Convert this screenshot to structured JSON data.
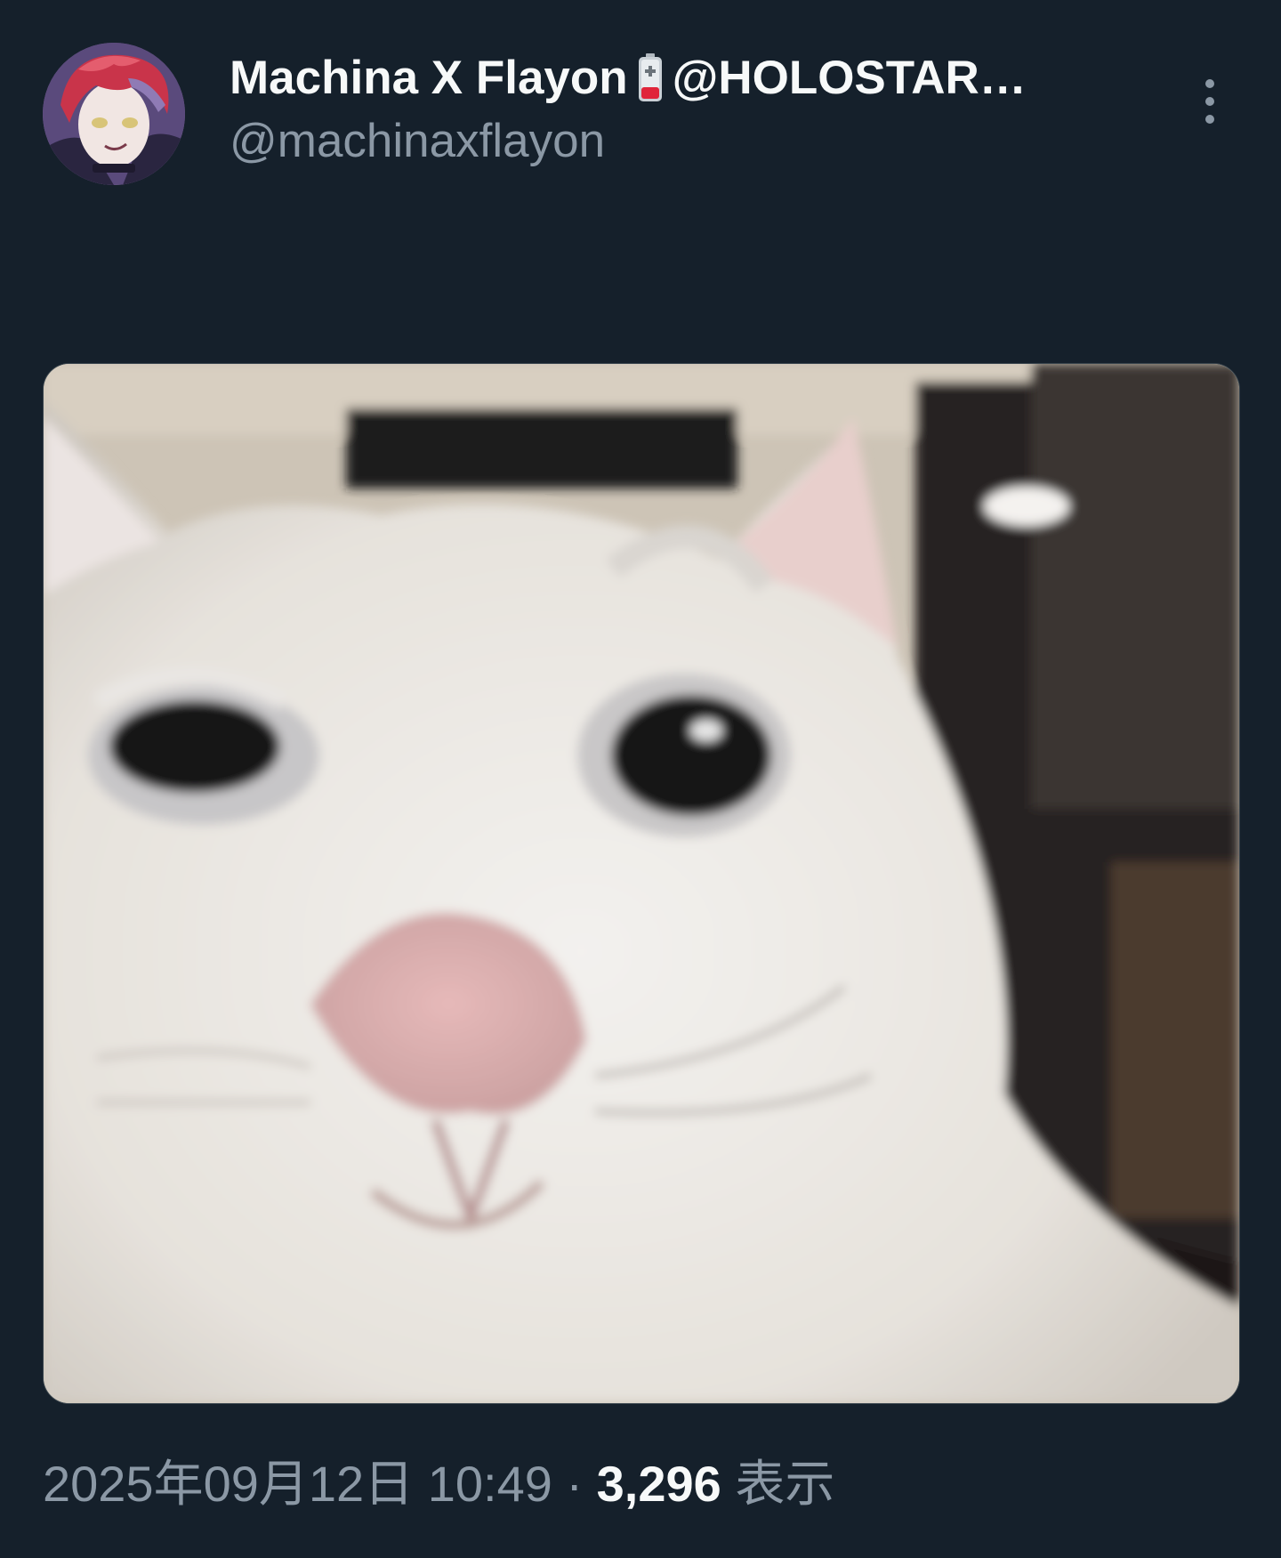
{
  "author": {
    "display_name": "Machina X Flayon",
    "name_suffix": "@HOLOSTAR…",
    "handle": "@machinaxflayon",
    "badge_icon": "battery-icon",
    "avatar_icon": "avatar-illustration"
  },
  "media": {
    "alt": "Smirking white cat"
  },
  "meta": {
    "timestamp": "2025年09月12日 10:49",
    "separator": "·",
    "views_count": "3,296",
    "views_label": "表示"
  },
  "actions": {
    "more_icon": "more-vertical-icon"
  },
  "colors": {
    "background": "#15202b",
    "primary_text": "#f7f9f9",
    "secondary_text": "#8b98a5"
  }
}
